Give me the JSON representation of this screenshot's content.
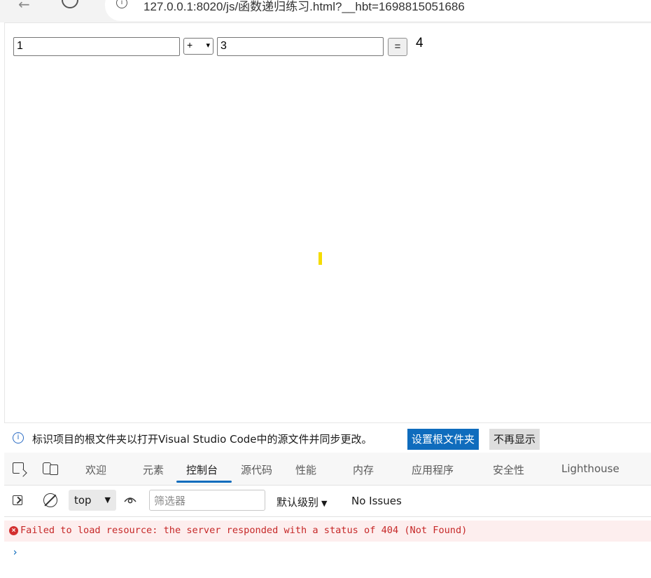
{
  "browser": {
    "url": "127.0.0.1:8020/js/函数递归练习.html?__hbt=1698815051686"
  },
  "page": {
    "input1_value": "1",
    "operator": "+",
    "input2_value": "3",
    "equals_label": "=",
    "result": "4"
  },
  "devtools": {
    "infobar": {
      "message": "标识项目的根文件夹以打开Visual Studio Code中的源文件并同步更改。",
      "primary_button": "设置根文件夹",
      "secondary_button": "不再显示"
    },
    "tabs": [
      {
        "label": "欢迎"
      },
      {
        "label": "元素"
      },
      {
        "label": "控制台",
        "active": true
      },
      {
        "label": "源代码"
      },
      {
        "label": "性能"
      },
      {
        "label": "内存"
      },
      {
        "label": "应用程序"
      },
      {
        "label": "安全性"
      },
      {
        "label": "Lighthouse"
      }
    ],
    "console": {
      "context": "top",
      "filter_placeholder": "筛选器",
      "levels_label": "默认级别",
      "issues_label": "No Issues",
      "messages": [
        {
          "level": "error",
          "text": "Failed to load resource: the server responded with a status of 404 (Not Found)"
        }
      ],
      "prompt": "›"
    },
    "colors": {
      "accent": "#0f6cbd",
      "error_text": "#c62828",
      "error_bg": "#fdeeee"
    }
  }
}
